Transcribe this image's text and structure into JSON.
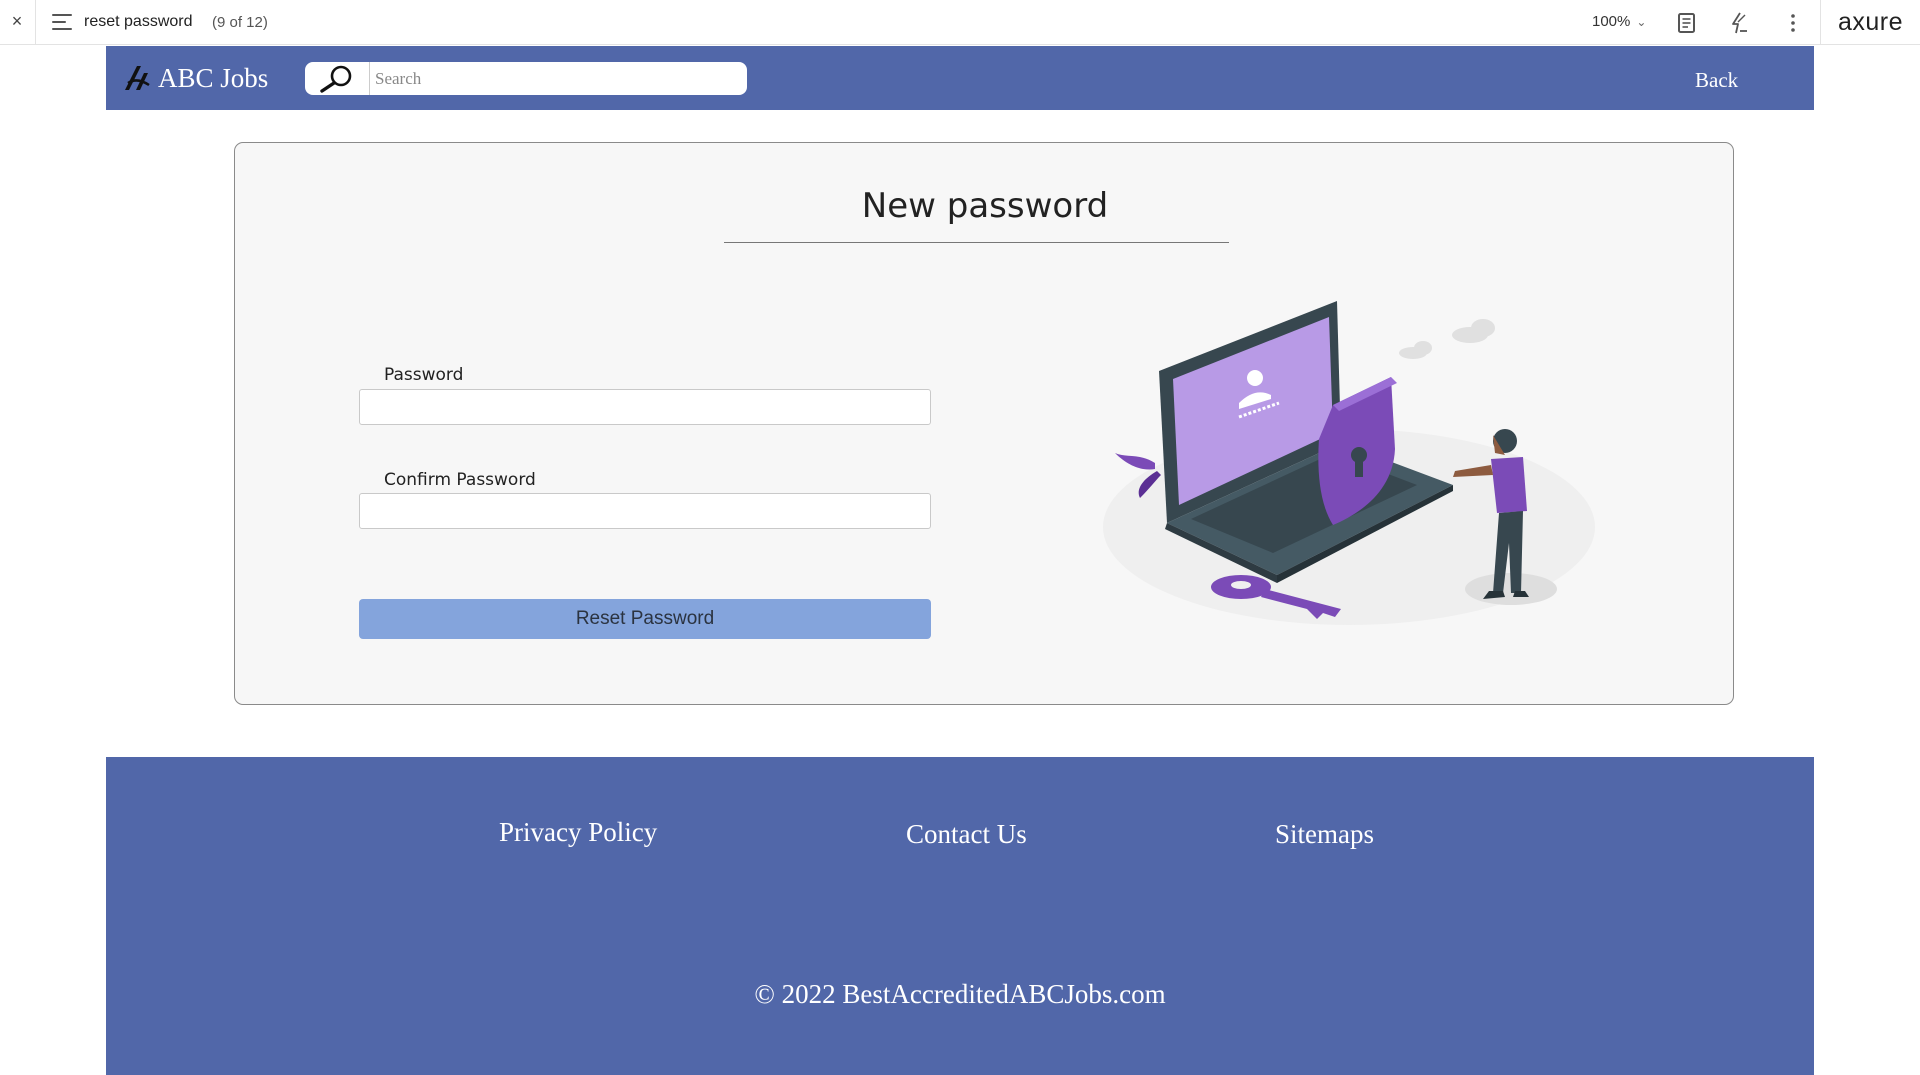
{
  "axure_bar": {
    "close_symbol": "×",
    "page_title": "reset password",
    "page_count": "(9 of 12)",
    "zoom": "100%",
    "logo": "axure",
    "icons": [
      "close-icon",
      "menu-icon",
      "chevron-down-icon",
      "notes-icon",
      "interactions-icon",
      "more-icon"
    ]
  },
  "header": {
    "brand": "ABC Jobs",
    "search_placeholder": "Search",
    "back_label": "Back",
    "color": "#5167a9"
  },
  "form": {
    "title": "New password",
    "password_label": "Password",
    "confirm_label": "Confirm Password",
    "password_value": "",
    "confirm_value": "",
    "submit_label": "Reset Password",
    "button_color": "#84a4dc"
  },
  "footer": {
    "links": [
      "Privacy Policy",
      "Contact Us",
      "Sitemaps"
    ],
    "copyright": "© 2022 BestAccreditedABCJobs.com"
  }
}
